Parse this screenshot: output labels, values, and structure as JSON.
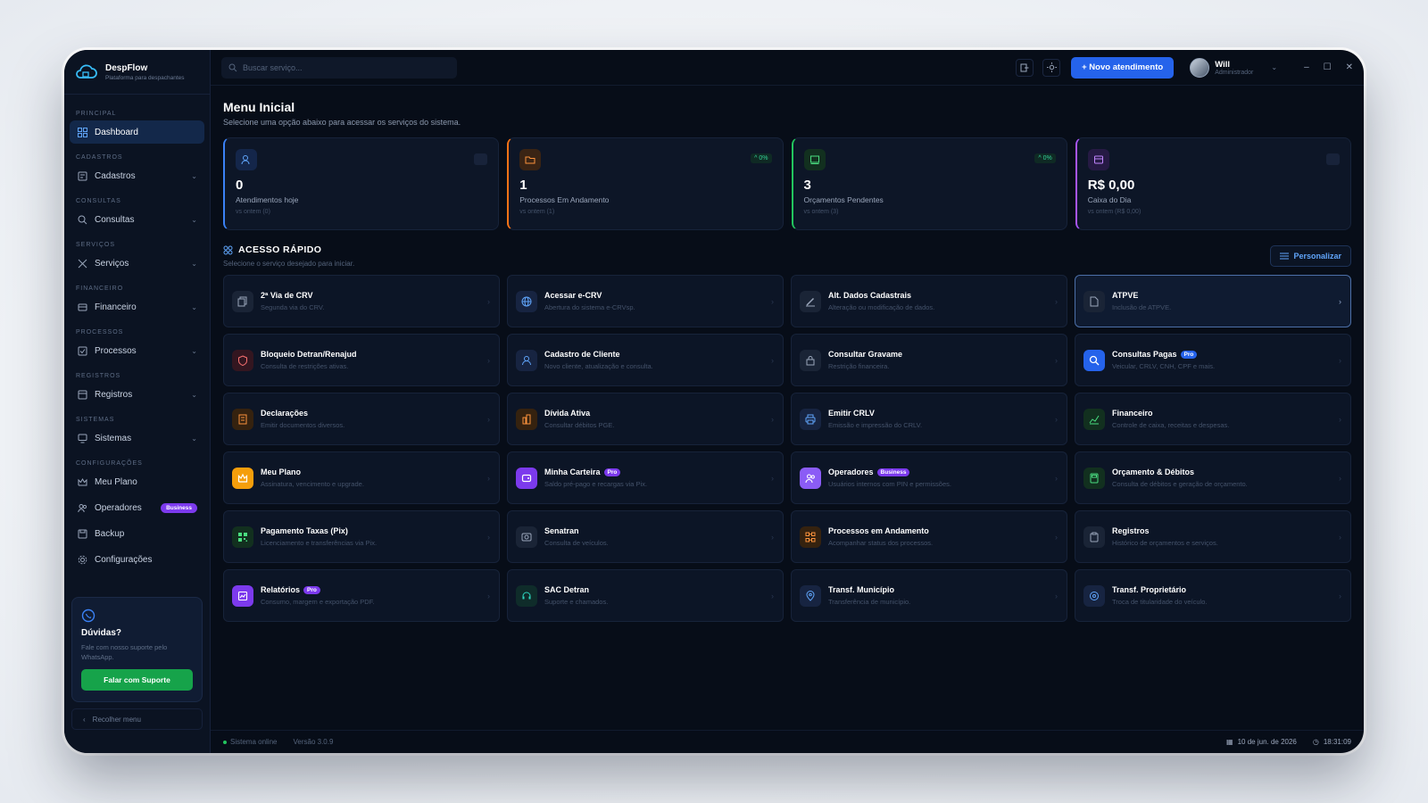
{
  "app": {
    "name": "DespFlow",
    "tagline": "Plataforma para despachantes"
  },
  "colors": {
    "accent": "#2563eb",
    "success": "#16a34a",
    "business": "#7c3aed"
  },
  "sidebar": {
    "sections": [
      {
        "title": "PRINCIPAL",
        "items": [
          {
            "label": "Dashboard",
            "icon": "dashboard-icon",
            "active": true
          }
        ]
      },
      {
        "title": "CADASTROS",
        "items": [
          {
            "label": "Cadastros",
            "icon": "id-card-icon"
          }
        ]
      },
      {
        "title": "CONSULTAS",
        "items": [
          {
            "label": "Consultas",
            "icon": "search-icon"
          }
        ]
      },
      {
        "title": "SERVIÇOS",
        "items": [
          {
            "label": "Serviços",
            "icon": "tools-icon"
          }
        ]
      },
      {
        "title": "FINANCEIRO",
        "items": [
          {
            "label": "Financeiro",
            "icon": "wallet-icon"
          }
        ]
      },
      {
        "title": "PROCESSOS",
        "items": [
          {
            "label": "Processos",
            "icon": "checklist-icon"
          }
        ]
      },
      {
        "title": "REGISTROS",
        "items": [
          {
            "label": "Registros",
            "icon": "register-icon"
          }
        ]
      },
      {
        "title": "SISTEMAS",
        "items": [
          {
            "label": "Sistemas",
            "icon": "monitor-icon"
          }
        ]
      },
      {
        "title": "CONFIGURAÇÕES",
        "items": [
          {
            "label": "Meu Plano",
            "icon": "crown-icon"
          },
          {
            "label": "Operadores",
            "icon": "users-icon",
            "badge": "Business"
          },
          {
            "label": "Backup",
            "icon": "backup-icon"
          },
          {
            "label": "Configurações",
            "icon": "gear-icon"
          }
        ]
      }
    ],
    "help": {
      "title": "Dúvidas?",
      "text": "Fale com nosso suporte pelo WhatsApp.",
      "button": "Falar com Suporte"
    },
    "collapse_label": "Recolher menu"
  },
  "topbar": {
    "search_placeholder": "Buscar serviço...",
    "new_button": "+ Novo atendimento",
    "user": {
      "name": "Will",
      "role": "Administrador"
    }
  },
  "page": {
    "title": "Menu Inicial",
    "subtitle": "Selecione uma opção abaixo para acessar os serviços do sistema."
  },
  "stats": [
    {
      "value": "0",
      "label": "Atendimentos hoje",
      "compare": "vs ontem (0)",
      "trend": "—",
      "color": "#3b82f6"
    },
    {
      "value": "1",
      "label": "Processos Em Andamento",
      "compare": "vs ontem (1)",
      "trend": "^ 0%",
      "color": "#f97316"
    },
    {
      "value": "3",
      "label": "Orçamentos Pendentes",
      "compare": "vs ontem (3)",
      "trend": "^ 0%",
      "color": "#22c55e"
    },
    {
      "value": "R$ 0,00",
      "label": "Caixa do Dia",
      "compare": "vs ontem (R$ 0,00)",
      "trend": "—",
      "color": "#a855f7"
    }
  ],
  "quick_access": {
    "title": "ACESSO RÁPIDO",
    "subtitle": "Selecione o serviço desejado para iniciar.",
    "personalize": "Personalizar",
    "cards": [
      {
        "title": "2ª Via de CRV",
        "desc": "Segunda via do CRV."
      },
      {
        "title": "Acessar e-CRV",
        "desc": "Abertura do sistema e-CRVsp."
      },
      {
        "title": "Alt. Dados Cadastrais",
        "desc": "Alteração ou modificação de dados."
      },
      {
        "title": "ATPVE",
        "desc": "Inclusão de ATPVE."
      },
      {
        "title": "Bloqueio Detran/Renajud",
        "desc": "Consulta de restrições ativas."
      },
      {
        "title": "Cadastro de Cliente",
        "desc": "Novo cliente, atualização e consulta."
      },
      {
        "title": "Consultar Gravame",
        "desc": "Restrição financeira."
      },
      {
        "title": "Consultas Pagas",
        "desc": "Veicular, CRLV, CNH, CPF e mais.",
        "badge": "Pro"
      },
      {
        "title": "Declarações",
        "desc": "Emitir documentos diversos."
      },
      {
        "title": "Dívida Ativa",
        "desc": "Consultar débitos PGE."
      },
      {
        "title": "Emitir CRLV",
        "desc": "Emissão e impressão do CRLV."
      },
      {
        "title": "Financeiro",
        "desc": "Controle de caixa, receitas e despesas."
      },
      {
        "title": "Meu Plano",
        "desc": "Assinatura, vencimento e upgrade."
      },
      {
        "title": "Minha Carteira",
        "desc": "Saldo pré-pago e recargas via Pix.",
        "badge": "Pro"
      },
      {
        "title": "Operadores",
        "desc": "Usuários internos com PIN e permissões.",
        "badge": "Business"
      },
      {
        "title": "Orçamento & Débitos",
        "desc": "Consulta de débitos e geração de orçamento."
      },
      {
        "title": "Pagamento Taxas (Pix)",
        "desc": "Licenciamento e transferências via Pix."
      },
      {
        "title": "Senatran",
        "desc": "Consulta de veículos."
      },
      {
        "title": "Processos em Andamento",
        "desc": "Acompanhar status dos processos."
      },
      {
        "title": "Registros",
        "desc": "Histórico de orçamentos e serviços."
      },
      {
        "title": "Relatórios",
        "desc": "Consumo, margem e exportação PDF.",
        "badge": "Pro"
      },
      {
        "title": "SAC Detran",
        "desc": "Suporte e chamados."
      },
      {
        "title": "Transf. Município",
        "desc": "Transferência de município."
      },
      {
        "title": "Transf. Proprietário",
        "desc": "Troca de titularidade do veículo."
      }
    ]
  },
  "footer": {
    "status": "Sistema online",
    "version": "Versão 3.0.9",
    "date": "10 de jun. de 2026",
    "time": "18:31:09"
  }
}
